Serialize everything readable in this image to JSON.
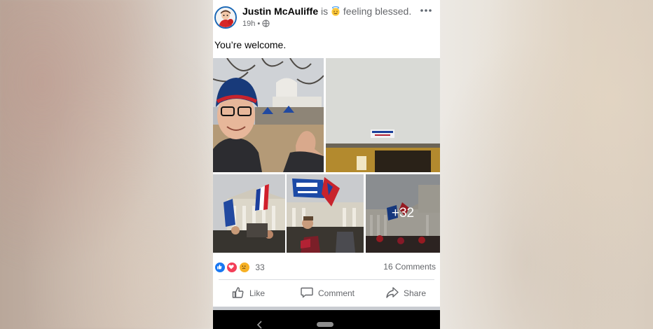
{
  "post": {
    "author": "Justin McAuliffe",
    "status_prefix": "is",
    "feeling_text": "feeling blessed.",
    "feeling_emoji_icon": "smiling-face-with-halo-icon",
    "time": "19h",
    "meta_separator": "•",
    "privacy_icon": "globe-icon",
    "text": "You’re welcome.",
    "more_icon": "more-options-icon"
  },
  "photos": {
    "more_count": "+32"
  },
  "stats": {
    "reaction_icons": [
      "like-reaction-icon",
      "love-reaction-icon",
      "sad-reaction-icon"
    ],
    "reaction_count": "33",
    "comments": "16 Comments"
  },
  "actions": {
    "like_label": "Like",
    "comment_label": "Comment",
    "share_label": "Share"
  },
  "colors": {
    "facebook_blue": "#1877f2",
    "love_red": "#f33e58",
    "sad_yellow": "#f7b125",
    "secondary_text": "#65676b"
  }
}
